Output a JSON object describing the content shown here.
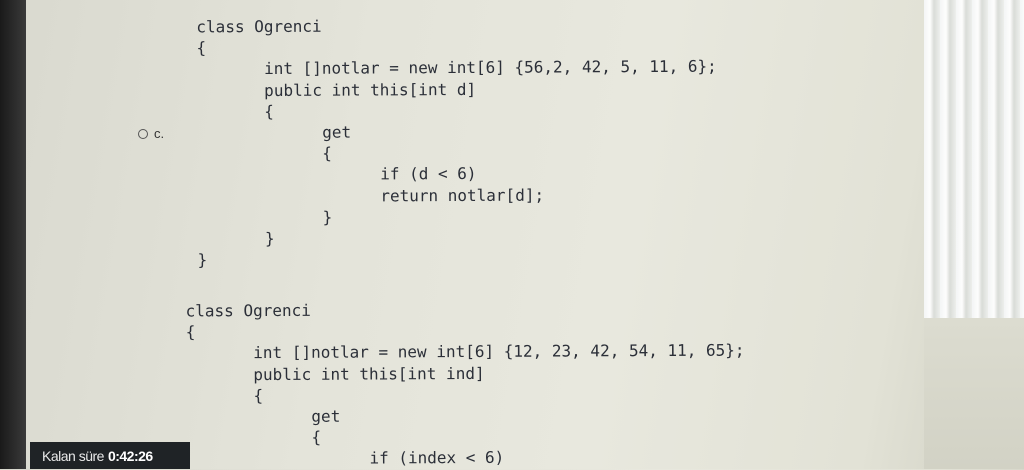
{
  "option_c": {
    "label": "c.",
    "code": "class Ogrenci\n{\n       int []notlar = new int[6] {56,2, 42, 5, 11, 6};\n       public int this[int d]\n       {\n             get\n             {\n                   if (d < 6)\n                   return notlar[d];\n             }\n       }\n}"
  },
  "option_d": {
    "code": "class Ogrenci\n{\n       int []notlar = new int[6] {12, 23, 42, 54, 11, 65};\n       public int this[int ind]\n       {\n             get\n             {\n                   if (index < 6)"
  },
  "timer": {
    "label": "Kalan süre",
    "value": "0:42:26"
  }
}
